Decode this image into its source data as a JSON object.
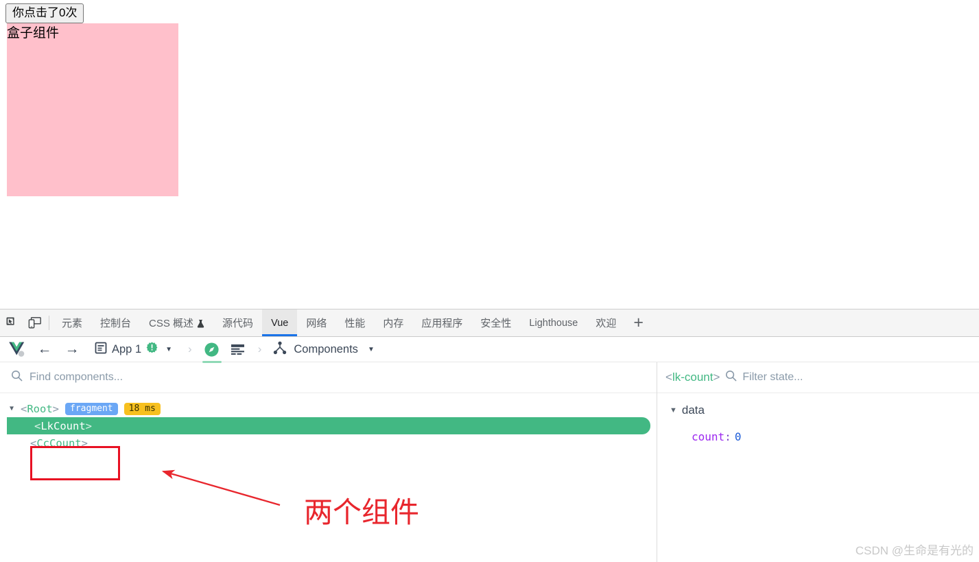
{
  "page": {
    "button_label": "你点击了0次",
    "box_label": "盒子组件",
    "box_color": "#ffc0cb"
  },
  "devtools": {
    "icons": {
      "inspect": "inspect-element-icon",
      "device": "device-toolbar-icon"
    },
    "tabs": [
      {
        "label": "元素",
        "active": false
      },
      {
        "label": "控制台",
        "active": false
      },
      {
        "label": "CSS 概述",
        "active": false,
        "flask": true
      },
      {
        "label": "源代码",
        "active": false
      },
      {
        "label": "Vue",
        "active": true
      },
      {
        "label": "网络",
        "active": false
      },
      {
        "label": "性能",
        "active": false
      },
      {
        "label": "内存",
        "active": false
      },
      {
        "label": "应用程序",
        "active": false
      },
      {
        "label": "安全性",
        "active": false
      },
      {
        "label": "Lighthouse",
        "active": false
      },
      {
        "label": "欢迎",
        "active": false
      }
    ],
    "add_tab_label": "+"
  },
  "vue": {
    "toolbar": {
      "logo": "vue-logo-icon",
      "back": "←",
      "forward": "→",
      "app_label": "App 1",
      "app_badge": "!",
      "app_caret": "▼",
      "chevron": "›",
      "components_label": "Components",
      "components_caret": "▼"
    },
    "tree_search_placeholder": "Find components...",
    "tree": [
      {
        "name": "Root",
        "open_bracket": "<",
        "close_bracket": ">",
        "twisty": "▼",
        "depth": 0,
        "selected": false,
        "tags": [
          {
            "text": "fragment",
            "kind": "fragment"
          },
          {
            "text": "18 ms",
            "kind": "ms"
          }
        ]
      },
      {
        "name": "LkCount",
        "open_bracket": "<",
        "close_bracket": ">",
        "twisty": "",
        "depth": 1,
        "selected": true,
        "tags": []
      },
      {
        "name": "CcCount",
        "open_bracket": "<",
        "close_bracket": ">",
        "twisty": "",
        "depth": 1,
        "selected": false,
        "tags": []
      }
    ],
    "annotation": {
      "text": "两个组件",
      "color": "#e8262d"
    },
    "state": {
      "title_open": "<",
      "title_name": "lk-count",
      "title_close": ">",
      "filter_placeholder": "Filter state...",
      "groups": [
        {
          "twisty": "▼",
          "label": "data",
          "entries": [
            {
              "key": "count",
              "colon": ":",
              "value": "0"
            }
          ]
        }
      ]
    }
  },
  "watermark": "CSDN @生命是有光的"
}
